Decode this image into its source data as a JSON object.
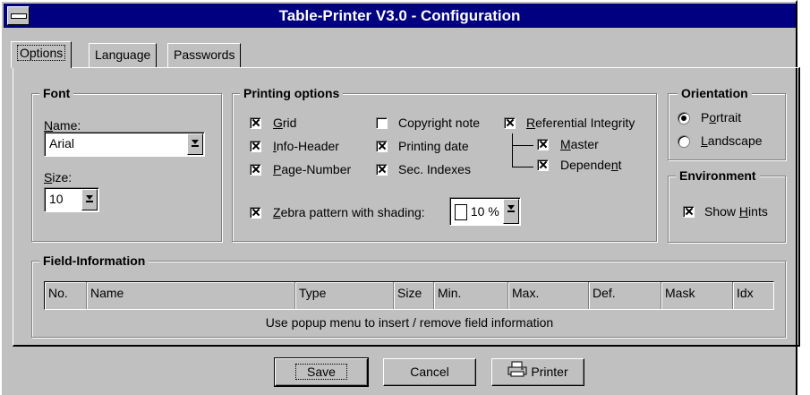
{
  "window": {
    "title": "Table-Printer V3.0 - Configuration"
  },
  "tabs": [
    "Options",
    "Language",
    "Passwords"
  ],
  "font": {
    "legend": "Font",
    "name_label": "Name:",
    "name_value": "Arial",
    "size_label": "Size:",
    "size_value": "10"
  },
  "printing": {
    "legend": "Printing options",
    "grid": "Grid",
    "info_header": "Info-Header",
    "page_number": "Page-Number",
    "copyright_note": "Copyright note",
    "printing_date": "Printing date",
    "sec_indexes": "Sec. Indexes",
    "referential_integrity": "Referential Integrity",
    "master": "Master",
    "dependent": "Dependent",
    "zebra": "Zebra pattern with shading:",
    "shading_value": "10 %",
    "checked": {
      "grid": true,
      "info_header": true,
      "page_number": true,
      "copyright_note": false,
      "printing_date": true,
      "sec_indexes": true,
      "referential_integrity": true,
      "master": true,
      "dependent": true,
      "zebra": true
    }
  },
  "orientation": {
    "legend": "Orientation",
    "portrait": "Portrait",
    "landscape": "Landscape",
    "selected": "portrait"
  },
  "environment": {
    "legend": "Environment",
    "show_hints": "Show Hints",
    "show_hints_checked": true
  },
  "field_info": {
    "legend": "Field-Information",
    "columns": [
      "No.",
      "Name",
      "Type",
      "Size",
      "Min.",
      "Max.",
      "Def.",
      "Mask",
      "Idx"
    ],
    "hint": "Use popup menu to insert / remove field information"
  },
  "buttons": {
    "save": "Save",
    "cancel": "Cancel",
    "printer": "Printer"
  }
}
